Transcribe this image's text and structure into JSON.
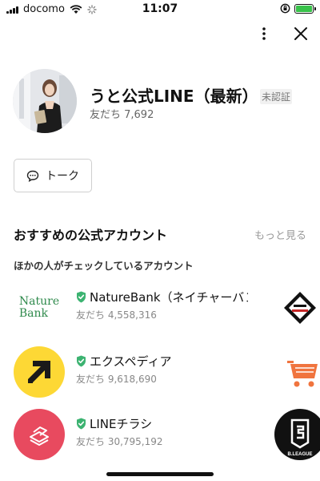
{
  "status_bar": {
    "carrier": "docomo",
    "time": "11:07",
    "battery_color": "#38c24a"
  },
  "top_actions": {
    "more_icon": "more-vertical-icon",
    "close_icon": "close-icon"
  },
  "profile": {
    "name": "うと公式LINE（最新）",
    "badge": "未認証",
    "friends": "友だち 7,692"
  },
  "talk_button": {
    "label": "トーク",
    "icon": "chat-bubble-icon"
  },
  "recommendations": {
    "title": "おすすめの公式アカウント",
    "more": "もっと見る",
    "subtitle": "ほかの人がチェックしているアカウント",
    "accounts": [
      {
        "name": "NatureBank（ネイチャーバン",
        "friends": "友だち 4,558,316",
        "logo_text": [
          "Nature",
          "Bank"
        ],
        "logo_color": "#2f8a4c"
      },
      {
        "name": "エクスペディア",
        "friends": "友だち 9,618,690",
        "logo_color": "#fdd835"
      },
      {
        "name": "LINEチラシ",
        "friends": "友だち 30,795,192",
        "logo_color": "#e84a5f"
      }
    ],
    "side_logos": [
      {
        "icon": "ichiban-kuji-logo-icon"
      },
      {
        "icon": "shopping-cart-icon",
        "color": "#f0743e"
      },
      {
        "icon": "b-league-logo-icon",
        "text": "B.LEAGUE"
      }
    ]
  },
  "accent": {
    "verified": "#3cb371"
  }
}
